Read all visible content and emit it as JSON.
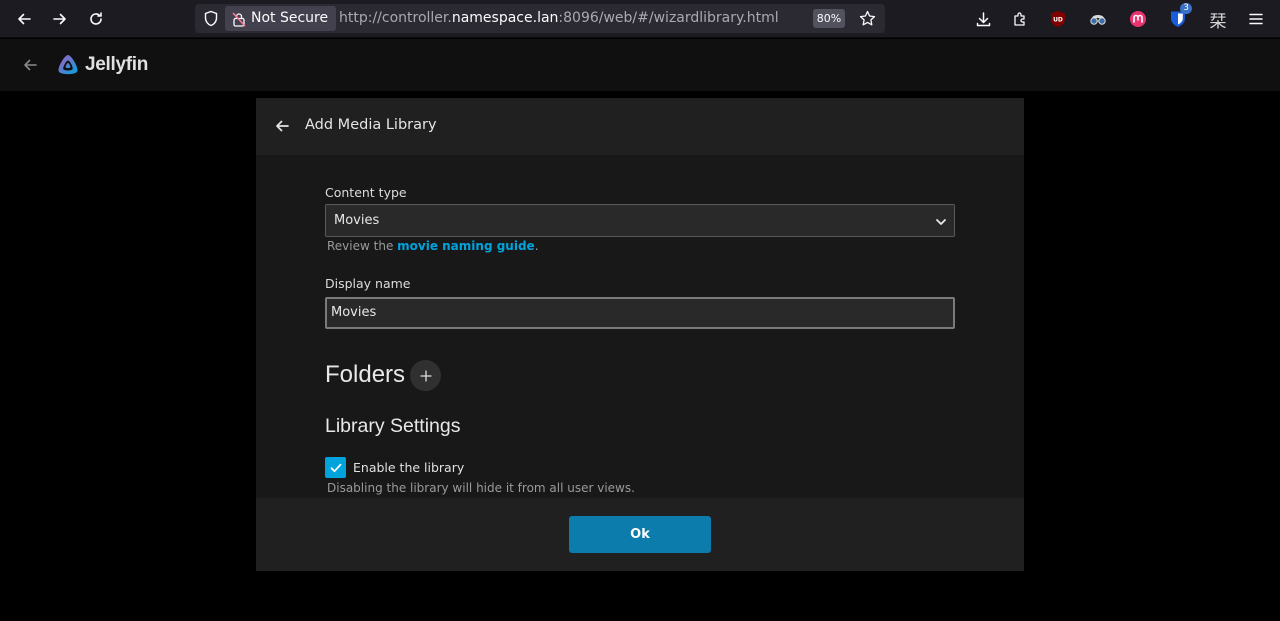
{
  "browser": {
    "security_label": "Not Secure",
    "url_prefix": "http://controller.",
    "url_host": "namespace.lan",
    "url_suffix": ":8096/web/#/wizardlibrary.html",
    "zoom": "80%",
    "extension_badge": "3",
    "extension_ud": "UD",
    "extension_glyph": "栞"
  },
  "app": {
    "logo_text": "Jellyfin"
  },
  "dialog": {
    "title": "Add Media Library",
    "content_type": {
      "label": "Content type",
      "selected": "Movies",
      "help_prefix": "Review the ",
      "help_link": "movie naming guide",
      "help_suffix": "."
    },
    "display_name": {
      "label": "Display name",
      "value": "Movies"
    },
    "folders": {
      "title": "Folders"
    },
    "library_settings": {
      "title": "Library Settings",
      "enable_label": "Enable the library",
      "enable_checked": true,
      "enable_help": "Disabling the library will hide it from all user views."
    },
    "ok_label": "Ok"
  },
  "colors": {
    "accent": "#00a4dc",
    "ok_button": "#0b7cab",
    "background": "#000000",
    "dialog": "#181818"
  }
}
